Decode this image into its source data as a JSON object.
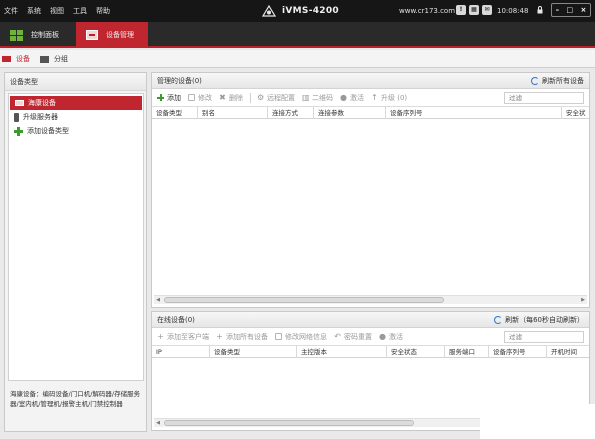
{
  "titlebar": {
    "menu": [
      "文件",
      "系统",
      "视图",
      "工具",
      "帮助"
    ],
    "app_name": "iVMS-4200",
    "url": "www.cr173.com",
    "time": "10:08:48",
    "window_controls": [
      "–",
      "□",
      "×"
    ]
  },
  "main_tabs": [
    {
      "label": "控制面板",
      "icon": "grid-icon"
    },
    {
      "label": "设备管理",
      "icon": "device-icon",
      "active": true
    }
  ],
  "sub_tabs": [
    {
      "label": "设备",
      "active": true
    },
    {
      "label": "分组"
    }
  ],
  "left_panel": {
    "title": "设备类型",
    "items": [
      {
        "label": "海康设备",
        "selected": true
      },
      {
        "label": "升级服务器"
      },
      {
        "label": "添加设备类型"
      }
    ],
    "note": "海康设备：编码设备/门口机/解码器/存储服务器/室内机/管理机/报警主机/门禁控制器"
  },
  "managed_devices": {
    "title": "管理的设备(0)",
    "refresh_label": "刷新所有设备",
    "toolbar": [
      "添加",
      "修改",
      "删除",
      "远程配置",
      "二维码",
      "激活",
      "升级 (0)"
    ],
    "filter_placeholder": "过滤",
    "columns": [
      "设备类型",
      "别名",
      "连接方式",
      "连接参数",
      "设备序列号",
      "安全状"
    ]
  },
  "online_devices": {
    "title": "在线设备(0)",
    "refresh_label": "刷新（每60秒自动刷新）",
    "toolbar": [
      "添加至客户端",
      "添加所有设备",
      "修改网络信息",
      "密码重置",
      "激活"
    ],
    "filter_placeholder": "过滤",
    "columns": [
      "IP",
      "设备类型",
      "主控版本",
      "安全状态",
      "服务端口",
      "设备序列号",
      "开机时间"
    ]
  },
  "colors": {
    "accent": "#c0262f",
    "titlebar_bg": "#161616",
    "green_icon": "#3d9a2e",
    "refresh_icon": "#2f77c8"
  }
}
